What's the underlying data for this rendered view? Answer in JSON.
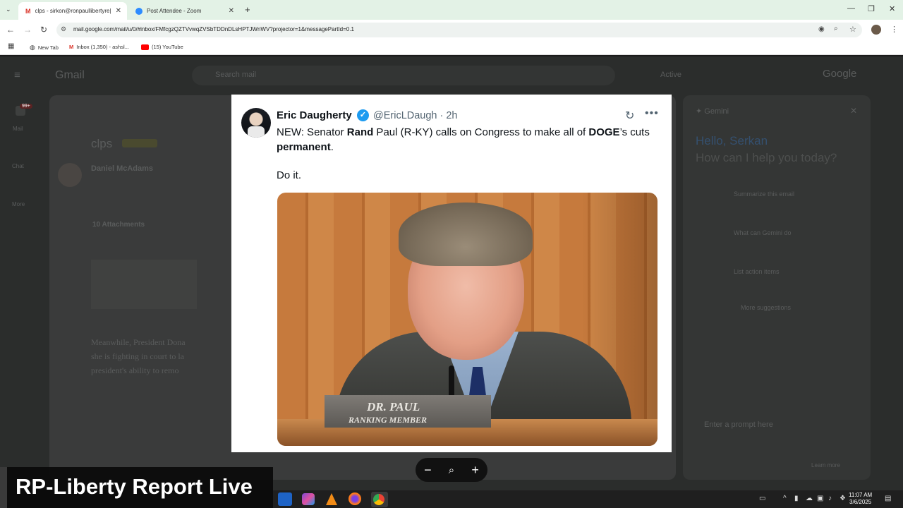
{
  "browser": {
    "tabs": [
      {
        "title": "clps - sirkon@ronpaullibertyre|",
        "active": true
      },
      {
        "title": "Post Attendee - Zoom",
        "active": false
      }
    ],
    "url": "mail.google.com/mail/u/0/#inbox/FMfcgzQZTVvwqZVSbTDDnDLsHPTJWnWV?projector=1&messagePartId=0.1",
    "bookmarks": [
      "New Tab",
      "Inbox (1,350) - ashsl...",
      "(15) YouTube"
    ]
  },
  "gmail": {
    "logo": "Gmail",
    "search_placeholder": "Search mail",
    "status": "Active",
    "subject": "clps",
    "sender": "Daniel McAdams",
    "attachments_label": "10 Attachments",
    "body_lines": [
      "Meanwhile, President Dona",
      "she is fighting in court to la",
      "president's ability to remo"
    ],
    "nav": [
      "Mail",
      "Chat",
      "More"
    ],
    "mail_badge": "99+"
  },
  "gemini": {
    "title": "Gemini",
    "greeting": "Hello, Serkan",
    "prompt": "How can I help you today?",
    "suggestions": [
      "Summarize this email",
      "What can Gemini do",
      "List action items"
    ],
    "more": "More suggestions",
    "input_placeholder": "Enter a prompt here",
    "learn_more": "Learn more"
  },
  "tweet": {
    "author": "Eric Daugherty",
    "handle": "@EricLDaugh · 2h",
    "text_parts": [
      "NEW: Senator ",
      "Rand",
      " Paul (R-KY) calls on Congress to make all of ",
      "DOGE",
      "’s cuts ",
      "permanent",
      "."
    ],
    "extra": "Do it.",
    "image": {
      "nameplate_line1": "DR. PAUL",
      "nameplate_line2": "RANKING MEMBER"
    }
  },
  "viewer": {
    "zoom_out": "−",
    "zoom_icon": "magnifier-icon",
    "zoom_in": "+"
  },
  "taskbar": {
    "time": "11:07 AM",
    "date": "3/6/2025"
  },
  "overlay": {
    "banner": "RP-Liberty Report Live"
  }
}
